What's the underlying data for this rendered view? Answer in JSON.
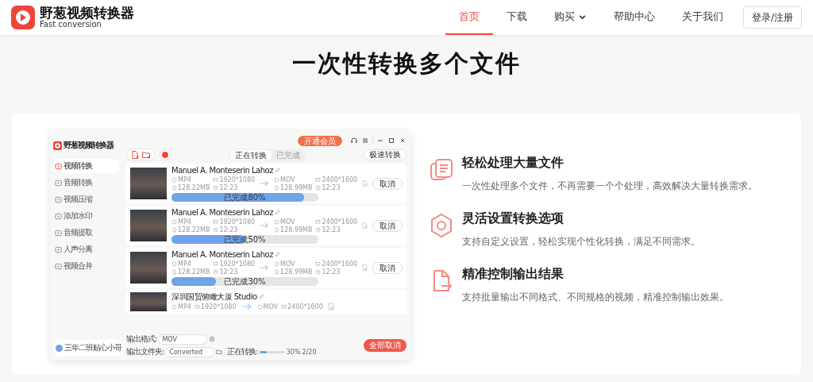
{
  "header": {
    "logo_title": "野葱视频转换器",
    "logo_subtitle": "Fast conversion",
    "nav": [
      {
        "label": "首页",
        "selected": true,
        "dropdown": false
      },
      {
        "label": "下载",
        "selected": false,
        "dropdown": false
      },
      {
        "label": "购买",
        "selected": false,
        "dropdown": true
      },
      {
        "label": "帮助中心",
        "selected": false,
        "dropdown": false
      },
      {
        "label": "关于我们",
        "selected": false,
        "dropdown": false
      }
    ],
    "login_button": "登录/注册"
  },
  "heading": "一次性转换多个文件",
  "app": {
    "title": "野葱视频转换器",
    "vip_button": "开通会员",
    "sidebar": [
      {
        "label": "视频转换",
        "selected": true
      },
      {
        "label": "音频转换",
        "selected": false
      },
      {
        "label": "视频压缩",
        "selected": false
      },
      {
        "label": "添加水印",
        "selected": false
      },
      {
        "label": "音频提取",
        "selected": false
      },
      {
        "label": "人声分离",
        "selected": false
      },
      {
        "label": "视频合并",
        "selected": false
      }
    ],
    "user": "三年二班贴心小哥",
    "tabs": [
      {
        "label": "正在转换",
        "selected": true
      },
      {
        "label": "已完成",
        "selected": false
      }
    ],
    "fast_button": "极速转换",
    "rows": [
      {
        "title": "Manuel A. Monteserin Lahoz",
        "source": [
          "MP4",
          "1920*1080",
          "128.22MB",
          "12:23"
        ],
        "target": [
          "MOV",
          "2400*1600",
          "128.99MB",
          "12:23"
        ],
        "progress": {
          "level": 0.9,
          "label": "已完成80%"
        },
        "button": "取消"
      },
      {
        "title": "Manuel A. Monteserin Lahoz",
        "source": [
          "MP4",
          "1920*1080",
          "128.22MB",
          "12:23"
        ],
        "target": [
          "MOV",
          "2400*1600",
          "128.99MB",
          "12:23"
        ],
        "progress": {
          "level": 0.5,
          "label": "已完成50%"
        },
        "button": "取消"
      },
      {
        "title": "Manuel A. Monteserin Lahoz",
        "source": [
          "MP4",
          "1920*1080",
          "128.22MB",
          "12:23"
        ],
        "target": [
          "MOV",
          "2400*1600",
          "128.99MB",
          "12:23"
        ],
        "progress": {
          "level": 0.3,
          "label": "已完成30%"
        },
        "button": "取消"
      },
      {
        "title": "深圳国贸俯瞰大厦 Studio",
        "source": [
          "MP4",
          "1920*1080"
        ],
        "target": [
          "MOV",
          "2400*1600"
        ]
      }
    ],
    "output_format_label": "输出格式:",
    "output_format": "MOV",
    "output_folder_label": "输出文件夹:",
    "output_folder": "Converted",
    "status_label": "正在转换:",
    "status_progress": {
      "level": 0.3
    },
    "status_percent": "30%",
    "status_count": "2/20",
    "cancel_all_button": "全部取消"
  },
  "features": [
    {
      "kind": "files",
      "title": "轻松处理大量文件",
      "description": "一次性处理多个文件，不再需要一个个处理，高效解决大量转换需求。"
    },
    {
      "kind": "settings",
      "title": "灵活设置转换选项",
      "description": "支持自定义设置，轻松实现个性化转换，满足不同需求。"
    },
    {
      "kind": "export",
      "title": "精准控制输出结果",
      "description": "支持批量输出不同格式、不同规格的视频，精准控制输出效果。"
    }
  ]
}
